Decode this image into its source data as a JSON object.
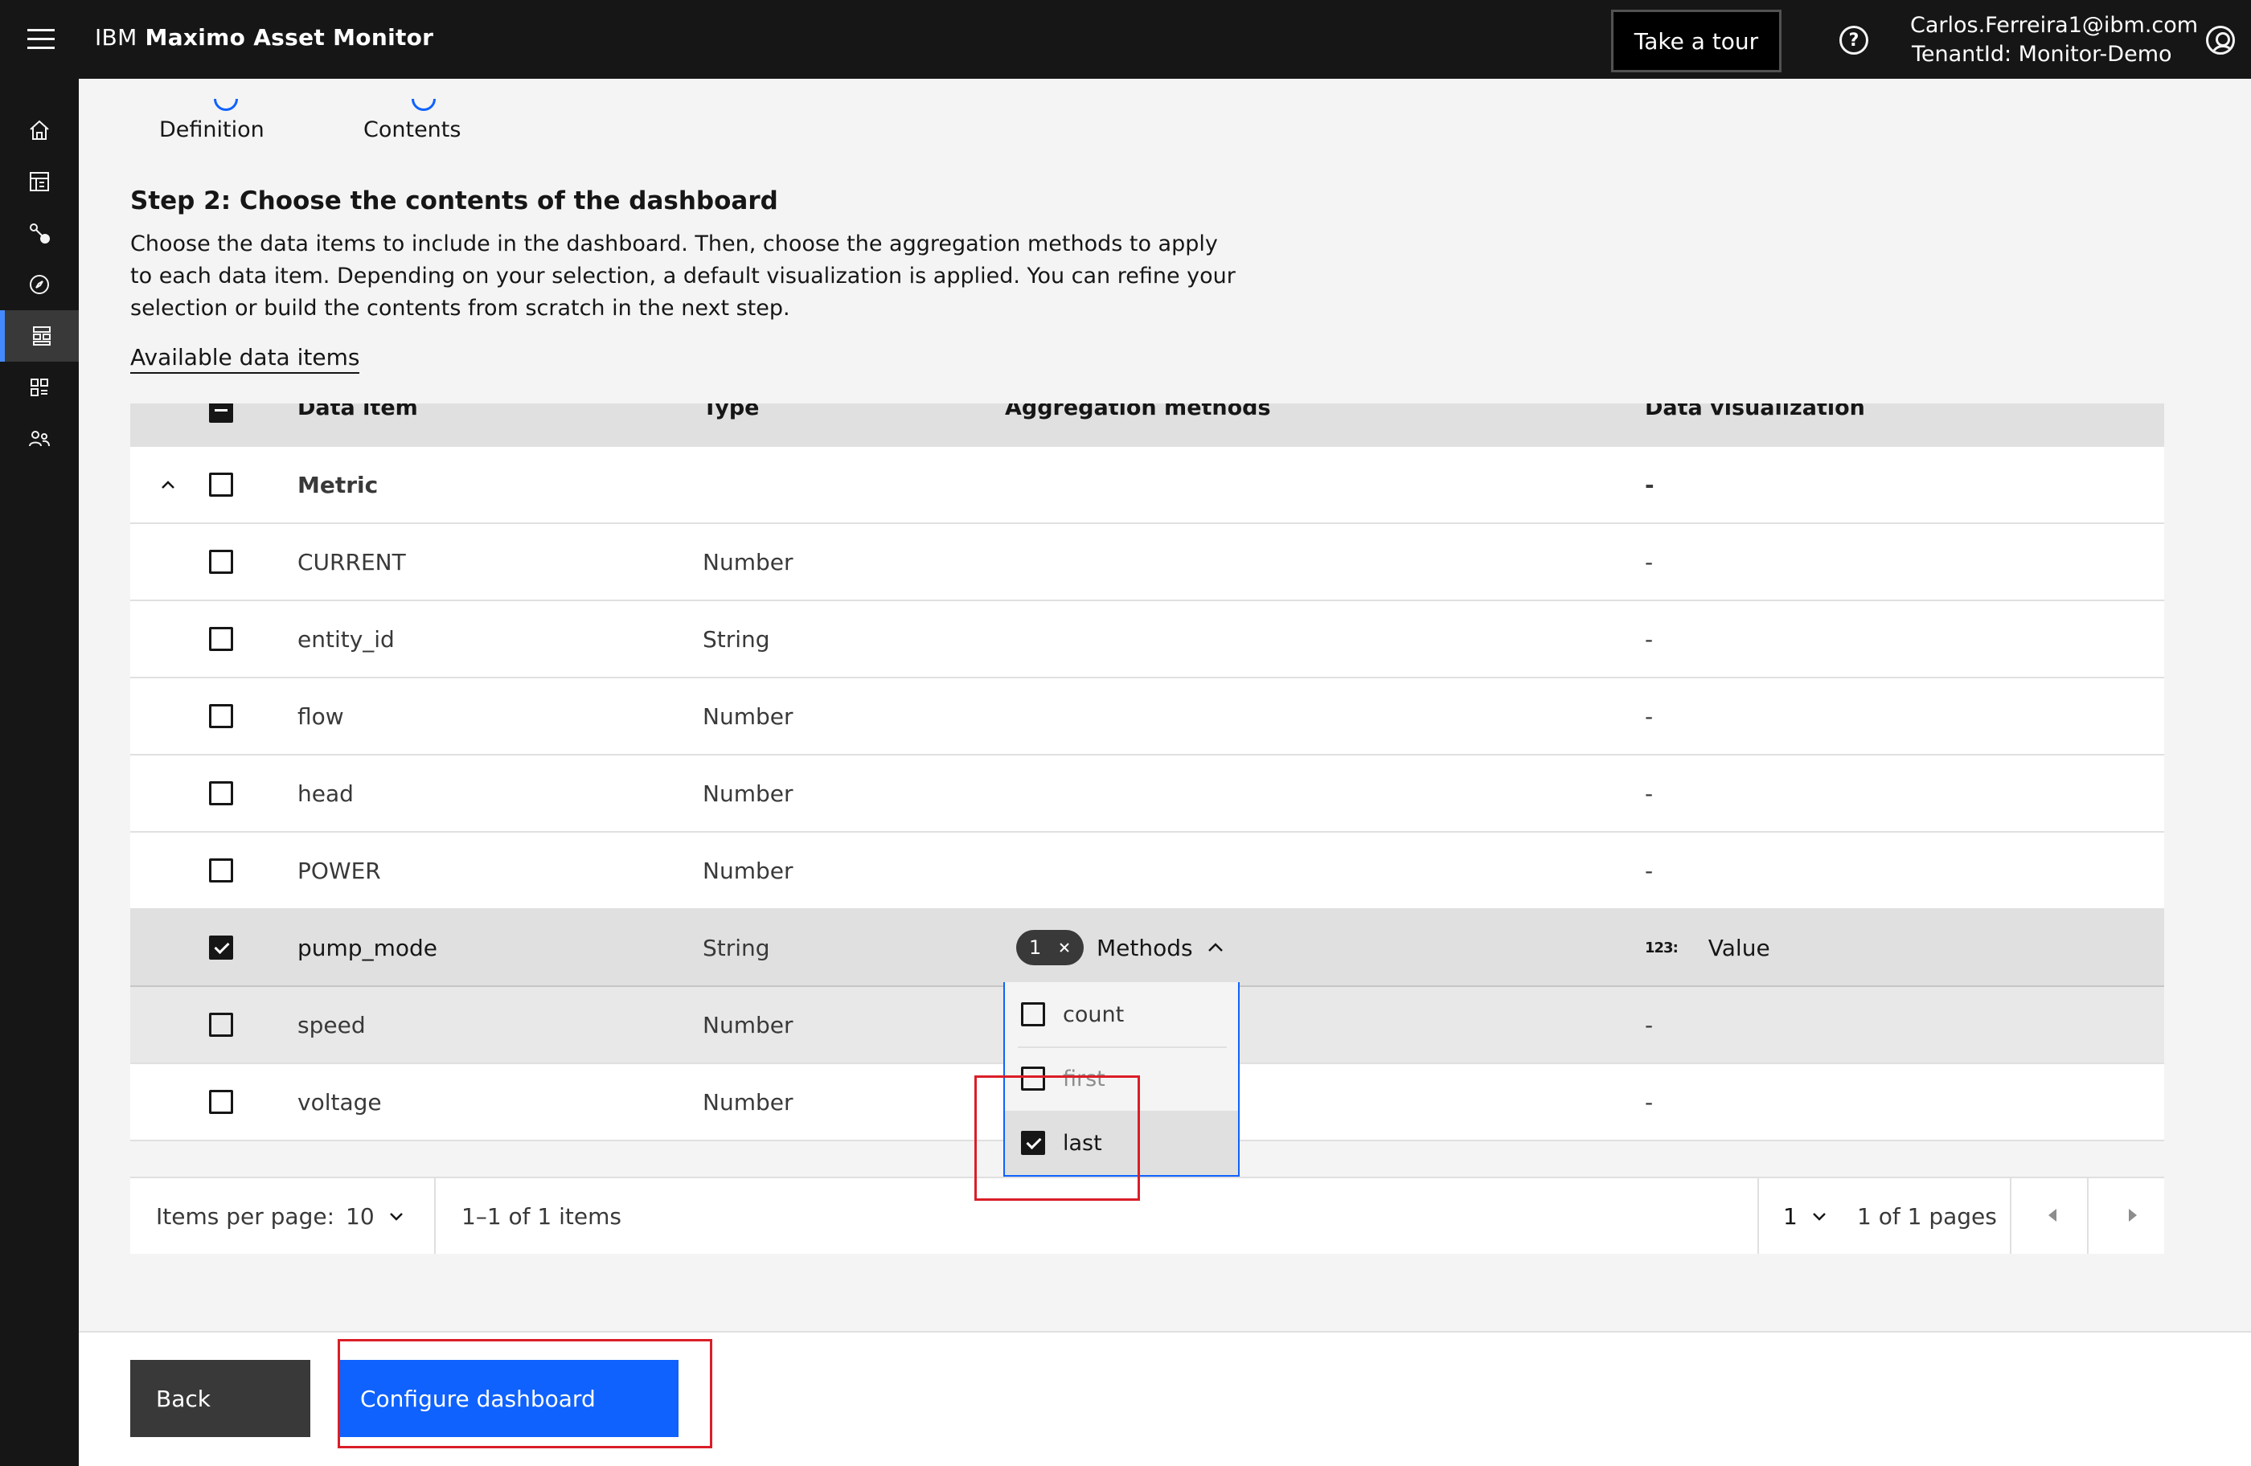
{
  "header": {
    "brand_prefix": "IBM",
    "product": "Maximo Asset Monitor",
    "tour_button": "Take a tour",
    "user_email": "Carlos.Ferreira1@ibm.com",
    "tenant": "TenantId: Monitor-Demo"
  },
  "sidenav": {
    "items": [
      "home-icon",
      "dashboard-icon",
      "devices-icon",
      "compass-icon",
      "dashboard-builder-icon",
      "apps-icon",
      "users-icon"
    ],
    "active_index": 4
  },
  "steps": {
    "step1": "Definition",
    "step2": "Contents"
  },
  "content": {
    "title": "Step 2: Choose the contents of the dashboard",
    "description": "Choose the data items to include in the dashboard. Then, choose the aggregation methods to apply to each data item. Depending on your selection, a default visualization is applied. You can refine your selection or build the contents from scratch in the next step.",
    "available_link": "Available data items"
  },
  "table": {
    "headers": {
      "data_item": "Data item",
      "type": "Type",
      "aggregation": "Aggregation methods",
      "visualization": "Data visualization"
    },
    "group_row": {
      "name": "Metric",
      "visualization": "-"
    },
    "rows": [
      {
        "name": "CURRENT",
        "type": "Number",
        "visualization": "-",
        "checked": false
      },
      {
        "name": "entity_id",
        "type": "String",
        "visualization": "-",
        "checked": false
      },
      {
        "name": "flow",
        "type": "Number",
        "visualization": "-",
        "checked": false
      },
      {
        "name": "head",
        "type": "Number",
        "visualization": "-",
        "checked": false
      },
      {
        "name": "POWER",
        "type": "Number",
        "visualization": "-",
        "checked": false
      },
      {
        "name": "pump_mode",
        "type": "String",
        "visualization": "Value",
        "checked": true,
        "methods_count": "1",
        "methods_label": "Methods",
        "viz_icon_text": "123:"
      },
      {
        "name": "speed",
        "type": "Number",
        "visualization": "-",
        "checked": false
      },
      {
        "name": "voltage",
        "type": "Number",
        "visualization": "-",
        "checked": false
      }
    ]
  },
  "methods_dropdown": {
    "options": [
      {
        "label": "count",
        "checked": false
      },
      {
        "label": "first",
        "checked": false
      },
      {
        "label": "last",
        "checked": true
      }
    ]
  },
  "pagination": {
    "items_per_page_label": "Items per page:",
    "items_per_page_value": "10",
    "range_text": "1–1 of 1 items",
    "page_value": "1",
    "pages_text": "1 of 1 pages"
  },
  "footer": {
    "back_label": "Back",
    "configure_label": "Configure dashboard"
  },
  "colors": {
    "accent": "#0f62fe",
    "highlight_box": "#da1e28",
    "header_bg": "#161616"
  }
}
